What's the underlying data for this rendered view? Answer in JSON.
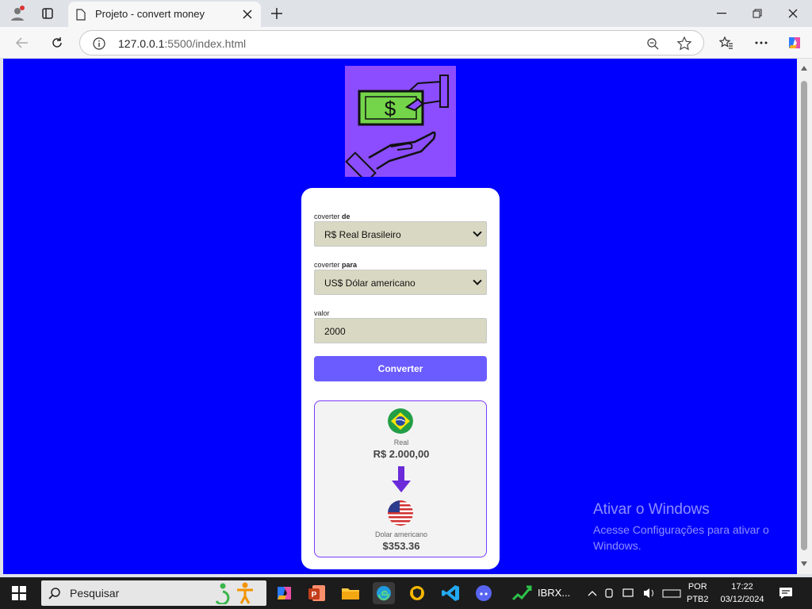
{
  "browser": {
    "tab_title": "Projeto - convert money",
    "url_host": "127.0.0.1",
    "url_rest": ":5500/index.html"
  },
  "form": {
    "from_label_prefix": "coverter ",
    "from_label_strong": "de",
    "from_value": "R$ Real Brasileiro",
    "to_label_prefix": "coverter ",
    "to_label_strong": "para",
    "to_value": "US$ Dólar americano",
    "amount_label": "valor",
    "amount_value": "2000",
    "convert_label": "Converter"
  },
  "result": {
    "from_currency": "Real",
    "from_amount": "R$ 2.000,00",
    "to_currency": "Dolar americano",
    "to_amount": "$353.36"
  },
  "watermark": {
    "title": "Ativar o Windows",
    "subtitle": "Acesse Configurações para ativar o Windows."
  },
  "taskbar": {
    "search_label": "Pesquisar",
    "app_label": "IBRX...",
    "lang_line1": "POR",
    "lang_line2": "PTB2",
    "time": "17:22",
    "date": "03/12/2024"
  },
  "colors": {
    "page_bg": "#0000ff",
    "logo_bg": "#8b4dff",
    "button": "#6a5cff",
    "result_border": "#7a3bff"
  }
}
